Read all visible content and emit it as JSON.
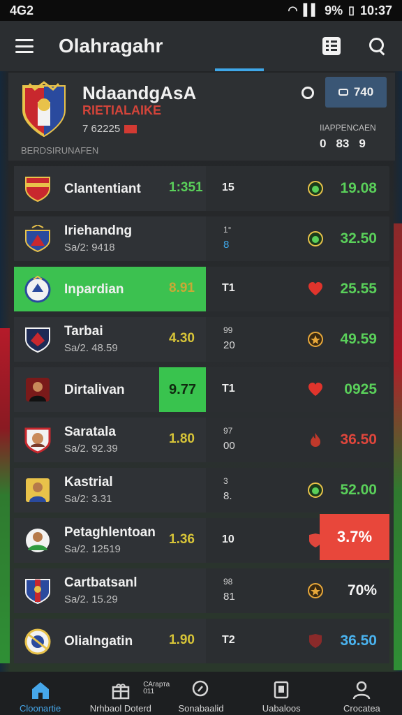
{
  "status_bar": {
    "left": "4G2",
    "battery": "9%",
    "time": "10:37"
  },
  "app": {
    "title": "Olahragahr"
  },
  "header": {
    "team_name": "NdaandgAsA",
    "team_subtitle": "RIETIALAIKE",
    "team_stat": "7 62225",
    "caption": "BERDSIRUNAFEN",
    "button_label": "740",
    "meta_label": "IIAPPENCAEN",
    "meta_values": [
      "0",
      "83",
      "9"
    ]
  },
  "rows": [
    {
      "name": "Clantentiant",
      "sub": "",
      "rating": "1:351",
      "count": "15",
      "count_top": "",
      "count_bottom": "",
      "icon": "whistle-icon",
      "score": "19.08"
    },
    {
      "name": "Iriehandng",
      "sub": "Sa/2: 9418",
      "rating": "",
      "count": "",
      "count_top": "1°",
      "count_bottom": "8",
      "icon": "whistle-icon",
      "score": "32.50"
    },
    {
      "name": "Inpardian",
      "sub": "",
      "rating": "8.91",
      "count": "T1",
      "count_top": "",
      "count_bottom": "",
      "icon": "heart-icon",
      "score": "25.55"
    },
    {
      "name": "Tarbai",
      "sub": "Sa/2. 48.59",
      "rating": "4.30",
      "count": "",
      "count_top": "99",
      "count_bottom": "20",
      "icon": "medal-icon",
      "score": "49.59"
    },
    {
      "name": "Dirtalivan",
      "sub": "",
      "rating": "9.77",
      "count": "T1",
      "count_top": "",
      "count_bottom": "",
      "icon": "heart-icon",
      "score": "0925"
    },
    {
      "name": "Saratala",
      "sub": "Sa/2. 92.39",
      "rating": "1.80",
      "count": "",
      "count_top": "97",
      "count_bottom": "00",
      "icon": "flame-icon",
      "score": "36.50"
    },
    {
      "name": "Kastrial",
      "sub": "Sa/2: 3.31",
      "rating": "",
      "count": "",
      "count_top": "3",
      "count_bottom": "8.",
      "icon": "whistle-icon",
      "score": "52.00"
    },
    {
      "name": "Petaghlentoan",
      "sub": "Sa/2. 12519",
      "rating": "1.36",
      "count": "10",
      "count_top": "",
      "count_bottom": "",
      "icon": "shield-icon",
      "score": "3.7%"
    },
    {
      "name": "Cartbatsanl",
      "sub": "Sa/2. 15.29",
      "rating": "",
      "count": "",
      "count_top": "98",
      "count_bottom": "81",
      "icon": "medal-icon",
      "score": "70%"
    },
    {
      "name": "Olialngatin",
      "sub": "",
      "rating": "1.90",
      "count": "T2",
      "count_top": "",
      "count_bottom": "",
      "icon": "shield-icon",
      "score": "36.50"
    }
  ],
  "nav": {
    "extra_top": "САгарта",
    "extra_bottom": "011",
    "items": [
      {
        "label": "Cloonartie"
      },
      {
        "label": "Nrhbaol Doterd"
      },
      {
        "label": "Sonabaalid"
      },
      {
        "label": "Uabaloos"
      },
      {
        "label": "Crocatea"
      }
    ]
  },
  "colors": {
    "accent": "#3fa7e8",
    "highlight_green": "#3cc150",
    "score_green": "#5ad05a",
    "score_red": "#e0463c",
    "button": "#3a5675"
  }
}
